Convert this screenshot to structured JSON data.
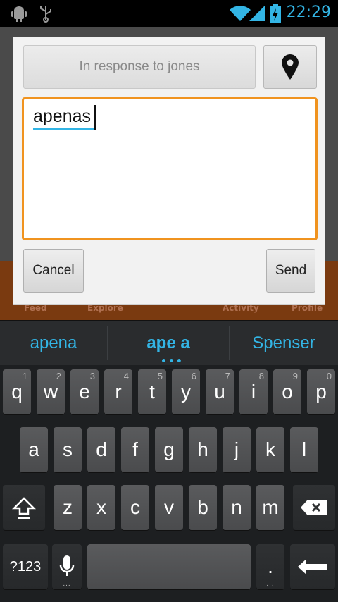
{
  "status_bar": {
    "time": "22:29"
  },
  "background_app": {
    "tabs": [
      "Feed",
      "Explore",
      "Activity",
      "Profile"
    ]
  },
  "dialog": {
    "in_response_label": "In response to jones",
    "text_value": "apenas",
    "cancel_label": "Cancel",
    "send_label": "Send"
  },
  "suggestions": [
    "apena",
    "ape a",
    "Spenser"
  ],
  "suggestion_more": "•••",
  "keyboard": {
    "row1": [
      {
        "c": "q",
        "h": "1"
      },
      {
        "c": "w",
        "h": "2"
      },
      {
        "c": "e",
        "h": "3"
      },
      {
        "c": "r",
        "h": "4"
      },
      {
        "c": "t",
        "h": "5"
      },
      {
        "c": "y",
        "h": "6"
      },
      {
        "c": "u",
        "h": "7"
      },
      {
        "c": "i",
        "h": "8"
      },
      {
        "c": "o",
        "h": "9"
      },
      {
        "c": "p",
        "h": "0"
      }
    ],
    "row2": [
      "a",
      "s",
      "d",
      "f",
      "g",
      "h",
      "j",
      "k",
      "l"
    ],
    "row3": [
      "z",
      "x",
      "c",
      "v",
      "b",
      "n",
      "m"
    ],
    "symbols_label": "?123",
    "period_label": ".",
    "key_dots": "..."
  },
  "colors": {
    "accent": "#33b5e5",
    "focus_border": "#f0931f"
  }
}
